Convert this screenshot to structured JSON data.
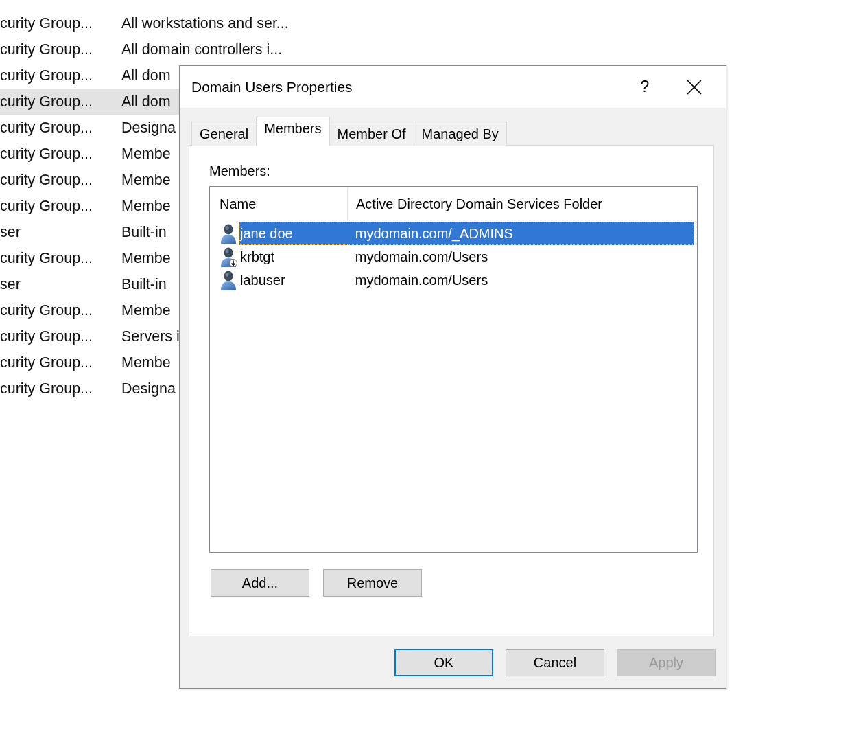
{
  "background_list": {
    "rows": [
      {
        "column_1": "curity Group...",
        "column_2": "All workstations and ser...",
        "selected": false
      },
      {
        "column_1": "curity Group...",
        "column_2": "All domain controllers i...",
        "selected": false
      },
      {
        "column_1": "curity Group...",
        "column_2": "All dom",
        "selected": false
      },
      {
        "column_1": "curity Group...",
        "column_2": "All dom",
        "selected": true
      },
      {
        "column_1": "curity Group...",
        "column_2": "Designa",
        "selected": false
      },
      {
        "column_1": "curity Group...",
        "column_2": "Membe",
        "selected": false
      },
      {
        "column_1": "curity Group...",
        "column_2": "Membe",
        "selected": false
      },
      {
        "column_1": "curity Group...",
        "column_2": "Membe",
        "selected": false
      },
      {
        "column_1": "ser",
        "column_2": "Built-in",
        "selected": false
      },
      {
        "column_1": "curity Group...",
        "column_2": "Membe",
        "selected": false
      },
      {
        "column_1": "ser",
        "column_2": "Built-in",
        "selected": false
      },
      {
        "column_1": "curity Group...",
        "column_2": "Membe",
        "selected": false
      },
      {
        "column_1": "curity Group...",
        "column_2": "Servers i",
        "selected": false
      },
      {
        "column_1": "curity Group...",
        "column_2": "Membe",
        "selected": false
      },
      {
        "column_1": "curity Group...",
        "column_2": "Designa",
        "selected": false
      }
    ]
  },
  "dialog": {
    "title": "Domain Users Properties",
    "help_button": "?",
    "tabs": [
      {
        "label": "General",
        "selected": false
      },
      {
        "label": "Members",
        "selected": true
      },
      {
        "label": "Member Of",
        "selected": false
      },
      {
        "label": "Managed By",
        "selected": false
      }
    ],
    "members_label": "Members:",
    "members_list": {
      "columns": [
        "Name",
        "Active Directory Domain Services Folder"
      ],
      "rows": [
        {
          "name": "jane doe",
          "folder": "mydomain.com/_ADMINS",
          "selected": true,
          "disabled": false
        },
        {
          "name": "krbtgt",
          "folder": "mydomain.com/Users",
          "selected": false,
          "disabled": true
        },
        {
          "name": "labuser",
          "folder": "mydomain.com/Users",
          "selected": false,
          "disabled": false
        }
      ]
    },
    "list_buttons": [
      {
        "label": "Add...",
        "disabled": false
      },
      {
        "label": "Remove",
        "disabled": false
      }
    ],
    "buttons": [
      {
        "label": "OK",
        "default": true,
        "disabled": false
      },
      {
        "label": "Cancel",
        "default": false,
        "disabled": false
      },
      {
        "label": "Apply",
        "default": false,
        "disabled": true
      }
    ]
  }
}
